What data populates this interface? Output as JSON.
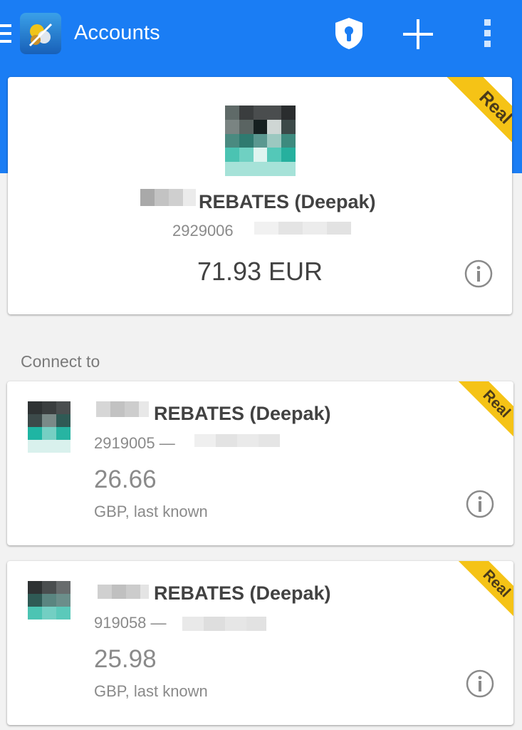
{
  "header": {
    "title": "Accounts",
    "menu_icon": "menu-icon",
    "logo_icon": "metatrader-logo-icon",
    "actions": [
      "shield-lock-icon",
      "plus-icon",
      "more-vert-icon"
    ],
    "accent_color": "#1a7df4"
  },
  "current_account": {
    "name": "REBATES (Deepak)",
    "number": "2929006",
    "balance": "71.93 EUR",
    "badge": "Real",
    "badge_color": "#f5c316"
  },
  "connect_section": {
    "label": "Connect to"
  },
  "accounts": [
    {
      "name": "REBATES (Deepak)",
      "number": "2919005 —",
      "balance": "26.66",
      "currency_note": "GBP, last known",
      "badge": "Real"
    },
    {
      "name": "REBATES (Deepak)",
      "number": "919058 —",
      "balance": "25.98",
      "currency_note": "GBP, last known",
      "badge": "Real"
    }
  ]
}
